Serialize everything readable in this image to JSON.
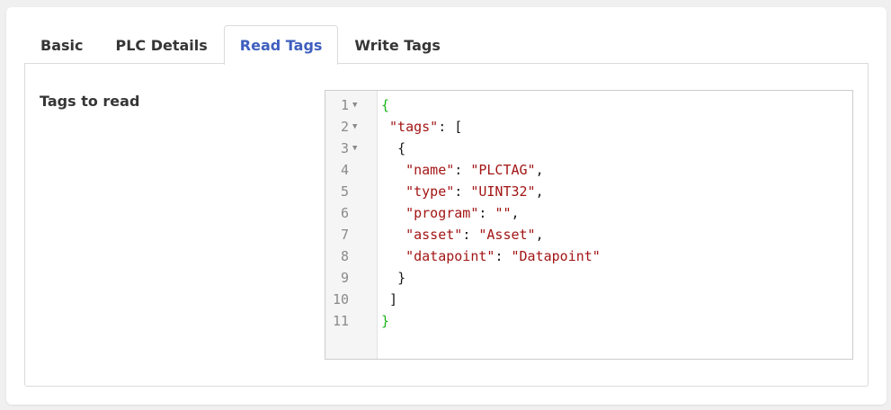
{
  "tabs": [
    {
      "label": "Basic",
      "active": false
    },
    {
      "label": "PLC Details",
      "active": false
    },
    {
      "label": "Read Tags",
      "active": true
    },
    {
      "label": "Write Tags",
      "active": false
    }
  ],
  "form": {
    "tags_label": "Tags to read"
  },
  "editor": {
    "line_numbers": [
      "1",
      "2",
      "3",
      "4",
      "5",
      "6",
      "7",
      "8",
      "9",
      "10",
      "11"
    ],
    "fold_marker": "▼",
    "lines": [
      {
        "indent": "",
        "key": "",
        "sep": "",
        "value": "",
        "open": "{",
        "close": "",
        "trail": ""
      },
      {
        "indent": " ",
        "key": "\"tags\"",
        "sep": ": ",
        "value": "",
        "open": "[",
        "close": "",
        "trail": ""
      },
      {
        "indent": "  ",
        "key": "",
        "sep": "",
        "value": "",
        "open": "{",
        "close": "",
        "trail": ""
      },
      {
        "indent": "   ",
        "key": "\"name\"",
        "sep": ": ",
        "value": "\"PLCTAG\"",
        "open": "",
        "close": "",
        "trail": ","
      },
      {
        "indent": "   ",
        "key": "\"type\"",
        "sep": ": ",
        "value": "\"UINT32\"",
        "open": "",
        "close": "",
        "trail": ","
      },
      {
        "indent": "   ",
        "key": "\"program\"",
        "sep": ": ",
        "value": "\"\"",
        "open": "",
        "close": "",
        "trail": ","
      },
      {
        "indent": "   ",
        "key": "\"asset\"",
        "sep": ": ",
        "value": "\"Asset\"",
        "open": "",
        "close": "",
        "trail": ","
      },
      {
        "indent": "   ",
        "key": "\"datapoint\"",
        "sep": ": ",
        "value": "\"Datapoint\"",
        "open": "",
        "close": "",
        "trail": ""
      },
      {
        "indent": "  ",
        "key": "",
        "sep": "",
        "value": "",
        "open": "",
        "close": "}",
        "trail": ""
      },
      {
        "indent": " ",
        "key": "",
        "sep": "",
        "value": "",
        "open": "",
        "close": "]",
        "trail": ""
      },
      {
        "indent": "",
        "key": "",
        "sep": "",
        "value": "",
        "open": "",
        "close": "}",
        "trail": ""
      }
    ],
    "foldable_lines": [
      0,
      1,
      2
    ],
    "colors": {
      "root_brace": "#19b319",
      "string": "#a31515",
      "punctuation": "#1a1a1a"
    }
  }
}
